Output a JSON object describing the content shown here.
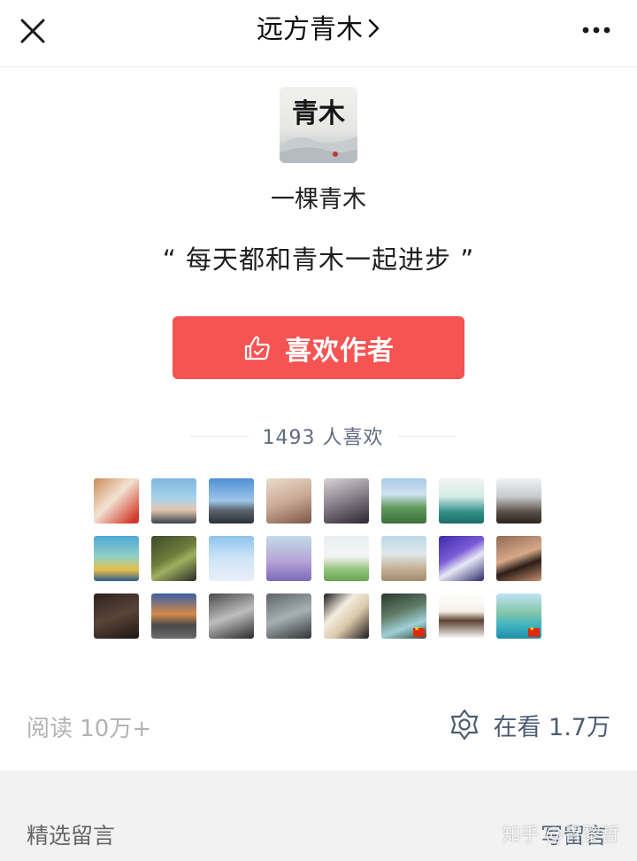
{
  "topbar": {
    "title": "远方青木",
    "close_icon": "close-icon",
    "more_icon": "more-dots-icon"
  },
  "author": {
    "avatar_text": "青木",
    "name": "一棵青木",
    "slogan": "“ 每天都和青木一起进步 ”"
  },
  "like_button": {
    "label": "喜欢作者",
    "icon": "thumbs-up-icon",
    "color": "#f55452"
  },
  "likes": {
    "count_text": "1493 人喜欢"
  },
  "liker_avatars": [
    {
      "name": "dog"
    },
    {
      "name": "beach-couple"
    },
    {
      "name": "city-towers"
    },
    {
      "name": "anime-girl"
    },
    {
      "name": "dark-figure"
    },
    {
      "name": "green-hills"
    },
    {
      "name": "whale"
    },
    {
      "name": "man-standing"
    },
    {
      "name": "road-sunset"
    },
    {
      "name": "music-note"
    },
    {
      "name": "long-hair-girl"
    },
    {
      "name": "purple-hair"
    },
    {
      "name": "field-woman"
    },
    {
      "name": "family-beach"
    },
    {
      "name": "dj-shirt"
    },
    {
      "name": "sunglasses-woman"
    },
    {
      "name": "dark-room"
    },
    {
      "name": "highway"
    },
    {
      "name": "white-dress"
    },
    {
      "name": "ghost-figure"
    },
    {
      "name": "piano-keys"
    },
    {
      "name": "rock-arch"
    },
    {
      "name": "cartoon-girl"
    },
    {
      "name": "resort-pool"
    }
  ],
  "stats": {
    "read": "阅读 10万+",
    "watching": "在看 1.7万",
    "watching_icon": "watching-flower-icon"
  },
  "comments": {
    "section_title": "精选留言",
    "write_label": "写留言"
  },
  "watermark": "知乎 @青黎哲"
}
